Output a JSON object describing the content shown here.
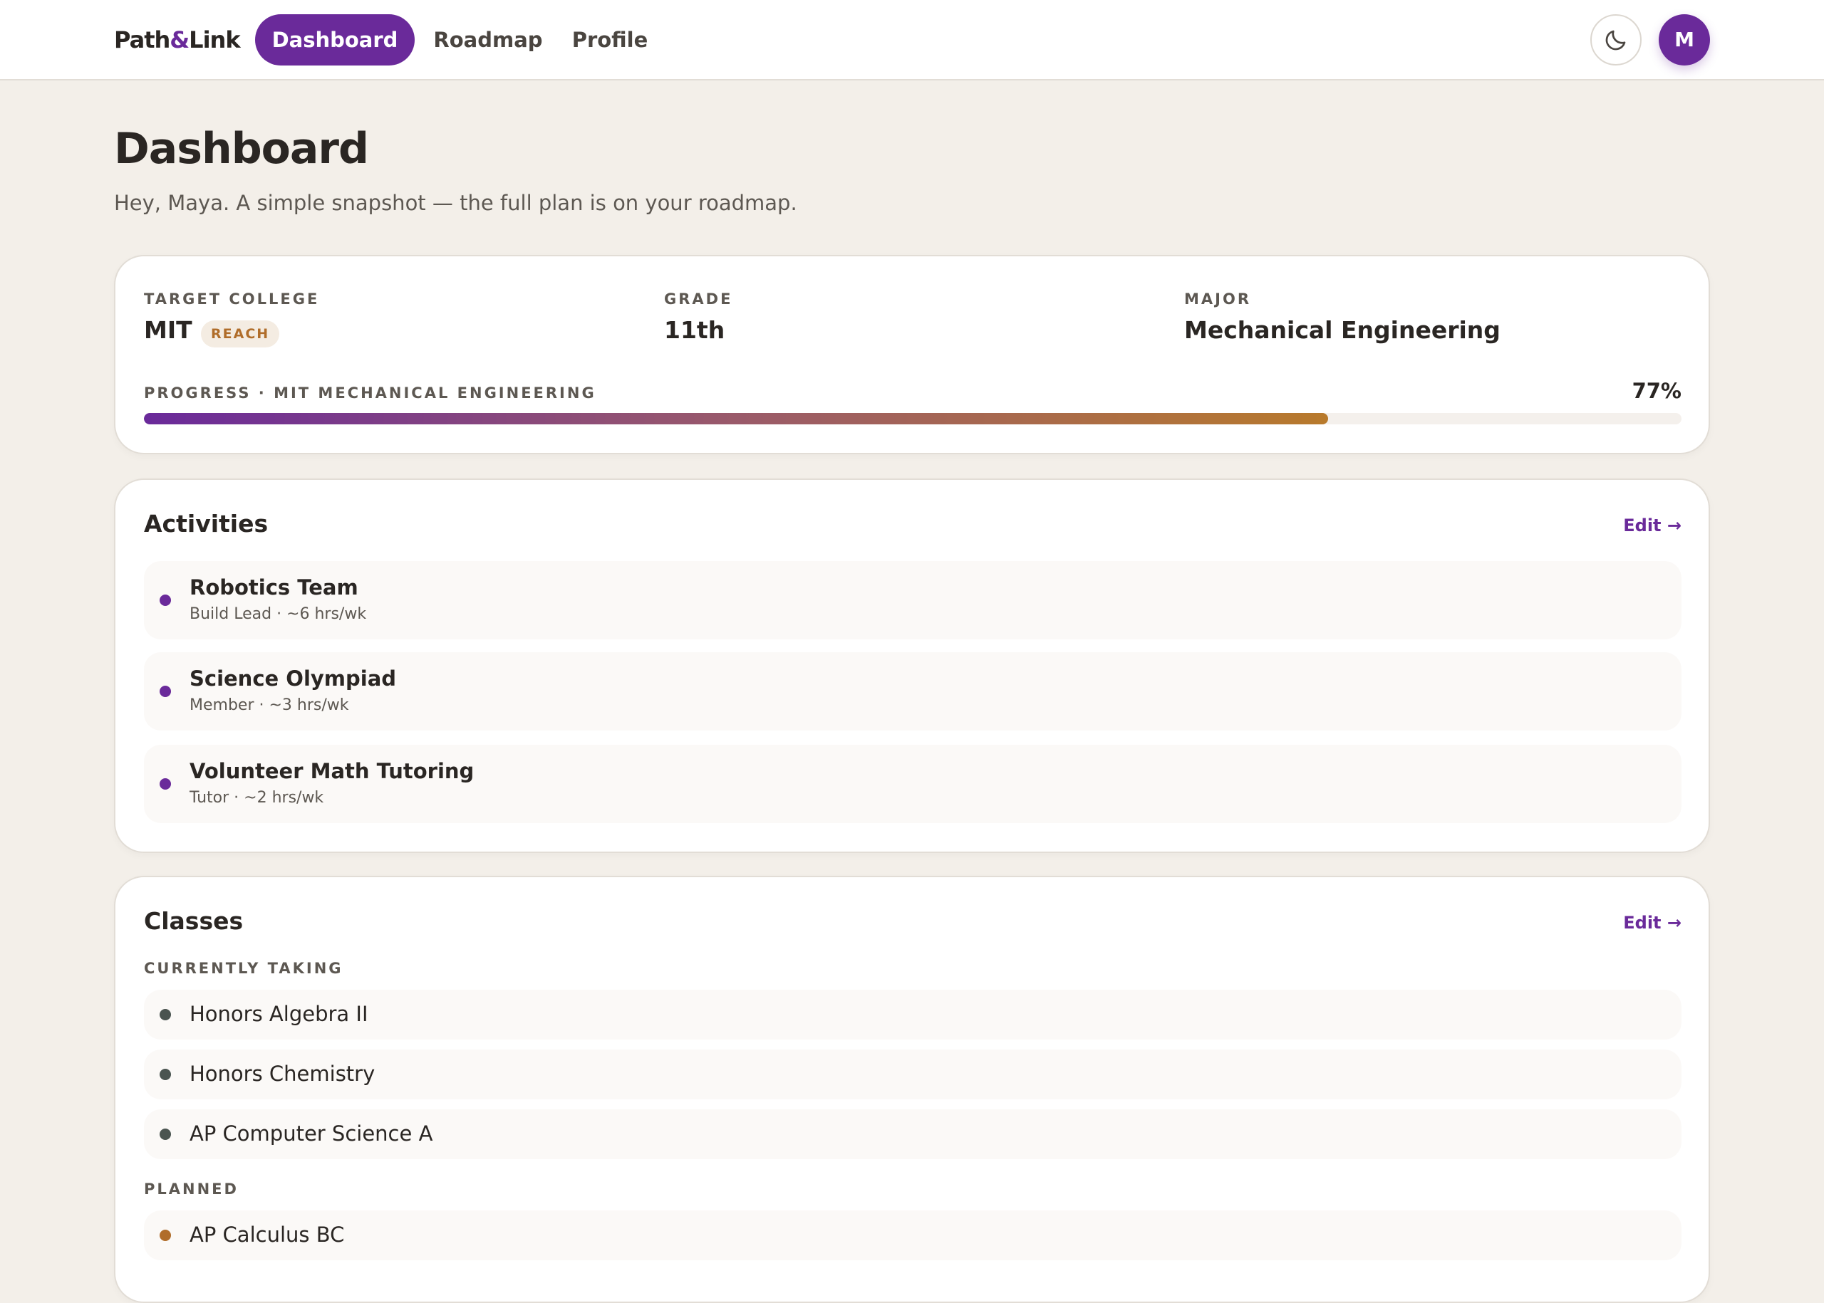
{
  "nav": {
    "logo_part1": "Path",
    "logo_amp": "&",
    "logo_part2": "Link",
    "items": [
      {
        "label": "Dashboard",
        "active": true
      },
      {
        "label": "Roadmap",
        "active": false
      },
      {
        "label": "Profile",
        "active": false
      }
    ],
    "theme_icon": "moon-icon",
    "avatar_initial": "M"
  },
  "header": {
    "title": "Dashboard",
    "subtitle": "Hey, Maya. A simple snapshot — the full plan is on your roadmap."
  },
  "summary": {
    "target_label": "TARGET COLLEGE",
    "target_value": "MIT",
    "target_badge": "REACH",
    "grade_label": "GRADE",
    "grade_value": "11th",
    "major_label": "MAJOR",
    "major_value": "Mechanical Engineering",
    "progress_label": "PROGRESS · MIT MECHANICAL ENGINEERING",
    "progress_text": "77%",
    "progress_value": 77
  },
  "activities": {
    "title": "Activities",
    "edit_label": "Edit →",
    "items": [
      {
        "name": "Robotics Team",
        "detail": "Build Lead · ~6 hrs/wk"
      },
      {
        "name": "Science Olympiad",
        "detail": "Member · ~3 hrs/wk"
      },
      {
        "name": "Volunteer Math Tutoring",
        "detail": "Tutor · ~2 hrs/wk"
      }
    ]
  },
  "classes": {
    "title": "Classes",
    "edit_label": "Edit →",
    "current_label": "CURRENTLY TAKING",
    "current": [
      "Honors Algebra II",
      "Honors Chemistry",
      "AP Computer Science A"
    ],
    "planned_label": "PLANNED",
    "planned": [
      "AP Calculus BC"
    ]
  },
  "colors": {
    "accent": "#6a2a9a",
    "reach": "#b06d2a",
    "current_dot": "#4a5450",
    "planned_dot": "#b06d2a",
    "background": "#f3efe9"
  }
}
